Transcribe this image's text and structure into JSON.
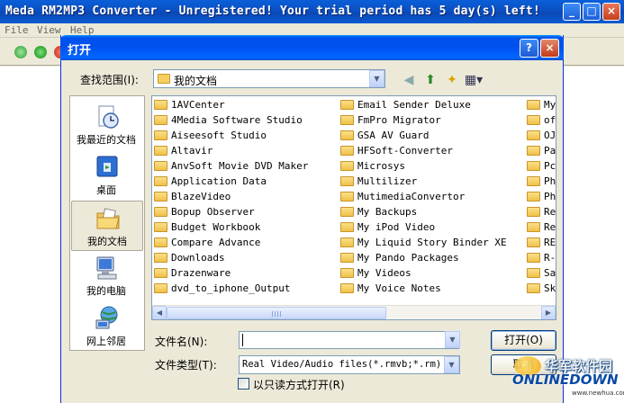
{
  "app": {
    "title": "Meda RM2MP3 Converter - Unregistered! Your trial period has 5 day(s) left!",
    "menu": [
      "File",
      "View",
      "Help"
    ],
    "window_buttons": {
      "minimize": "_",
      "maximize": "□",
      "close": "×"
    }
  },
  "dialog": {
    "title": "打开",
    "help_button": "?",
    "close_button": "×",
    "look_in_label": "查找范围(I):",
    "look_in_value": "我的文档",
    "places": [
      {
        "label": "我最近的文档",
        "icon": "recent-documents-icon"
      },
      {
        "label": "桌面",
        "icon": "desktop-icon"
      },
      {
        "label": "我的文档",
        "icon": "my-documents-icon"
      },
      {
        "label": "我的电脑",
        "icon": "my-computer-icon"
      },
      {
        "label": "网上邻居",
        "icon": "network-places-icon"
      }
    ],
    "files_col1": [
      "1AVCenter",
      "4Media Software Studio",
      "Aiseesoft Studio",
      "Altavir",
      "AnvSoft Movie DVD Maker",
      "Application Data",
      "BlazeVideo",
      "Bopup Observer",
      "Budget Workbook",
      "Compare Advance",
      "Downloads",
      "Drazenware",
      "dvd_to_iphone_Output"
    ],
    "files_col2": [
      "Email Sender Deluxe",
      "FmPro Migrator",
      "GSA AV Guard",
      "HFSoft-Converter",
      "Microsys",
      "Multilizer",
      "MutimediaConvertor",
      "My Backups",
      "My iPod Video",
      "My Liquid Story Binder XE",
      "My Pando Packages",
      "My Videos",
      "My Voice Notes"
    ],
    "files_col3": [
      "My",
      "of",
      "OJ",
      "Pa",
      "Pc",
      "Ph",
      "Ph",
      "Re",
      "Re",
      "RE",
      "R-",
      "Sa",
      "Sk"
    ],
    "filename_label": "文件名(N):",
    "filename_value": "",
    "filetype_label": "文件类型(T):",
    "filetype_value": "Real Video/Audio files(*.rmvb;*.rm)",
    "open_button": "打开(O)",
    "cancel_button": "取消",
    "readonly_label": "以只读方式打开(R)",
    "readonly_checked": false
  },
  "watermark": {
    "cn": "华军软件园",
    "en": "ONLINEDOWN",
    "url": "www.newhua.com"
  }
}
